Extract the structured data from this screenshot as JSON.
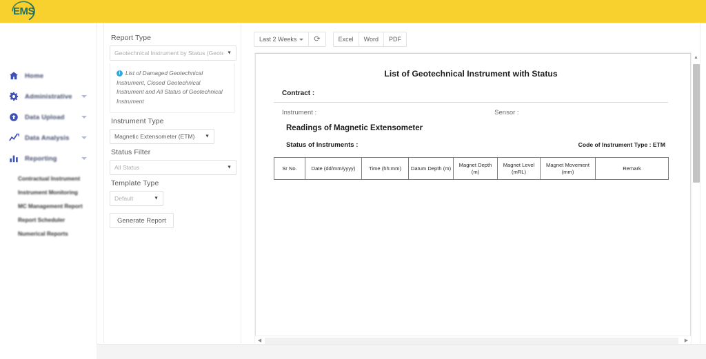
{
  "app": {
    "logo_text": "EMS",
    "header_color": "#F8D12F",
    "accent_color": "#3f51b5",
    "info_icon_color": "#31a8e0"
  },
  "sidebar": {
    "items": [
      {
        "label": "Home",
        "icon": "home-icon",
        "has_caret": false
      },
      {
        "label": "Administrative",
        "icon": "gear-icon",
        "has_caret": true
      },
      {
        "label": "Data Upload",
        "icon": "upload-icon",
        "has_caret": true
      },
      {
        "label": "Data Analysis",
        "icon": "line-chart-icon",
        "has_caret": true
      },
      {
        "label": "Reporting",
        "icon": "bar-chart-icon",
        "has_caret": true
      }
    ],
    "sub_items": [
      {
        "label": "Contractual Instrument"
      },
      {
        "label": "Instrument Monitoring"
      },
      {
        "label": "MC Management Report"
      },
      {
        "label": "Report Scheduler"
      },
      {
        "label": "Numerical Reports"
      }
    ],
    "collapse_icon": "chevron-left-icon"
  },
  "filters": {
    "report_type": {
      "label": "Report Type",
      "value": "Geotechnical Instrument by Status (Geotechr",
      "caret": "▼"
    },
    "info": {
      "icon": "info-icon",
      "text": "List of Damaged Geotechnical Instrument, Closed Geotechnical Instrument and All Status of Geotechnical Instrument"
    },
    "instrument_type": {
      "label": "Instrument Type",
      "value": "Magnetic Extensometer (ETM)",
      "caret": "▼"
    },
    "status_filter": {
      "label": "Status Filter",
      "value": "All Status",
      "caret": "▼"
    },
    "template_type": {
      "label": "Template Type",
      "value": "Default",
      "caret": "▼"
    },
    "generate_button": "Generate Report"
  },
  "toolbar": {
    "date_range": "Last 2 Weeks",
    "date_caret": "▾",
    "refresh_icon": "refresh-icon",
    "refresh_glyph": "⟳",
    "exports": [
      "Excel",
      "Word",
      "PDF"
    ]
  },
  "report": {
    "title": "List of Geotechnical Instrument with Status",
    "contract_label": "Contract  :",
    "instrument_label": "Instrument  :",
    "sensor_label": "Sensor  :",
    "readings_heading": "Readings of Magnetic Extensometer",
    "status_label": "Status of Instruments  :",
    "code_label": "Code of Instrument Type  : ETM",
    "table": {
      "columns": [
        "Sr No.",
        "Date (dd/mm/yyyy)",
        "Time (hh:mm)",
        "Datum Depth (m)",
        "Magnet Depth (m)",
        "Magnet Level (mRL)",
        "Magnet Movement (mm)",
        "Remark"
      ],
      "columns_multiline": [
        [
          "Sr No."
        ],
        [
          "Date (dd/mm/yyyy)"
        ],
        [
          "Time (hh:mm)"
        ],
        [
          "Datum Depth",
          "(m)"
        ],
        [
          "Magnet Depth",
          "(m)"
        ],
        [
          "Magnet Level",
          "(mRL)"
        ],
        [
          "Magnet Movement",
          "(mm)"
        ],
        [
          "Remark"
        ]
      ],
      "rows": []
    }
  },
  "scrollbars": {
    "vertical_up": "▲",
    "vertical_down": "▼",
    "horizontal_left": "◀",
    "horizontal_right": "▶"
  }
}
